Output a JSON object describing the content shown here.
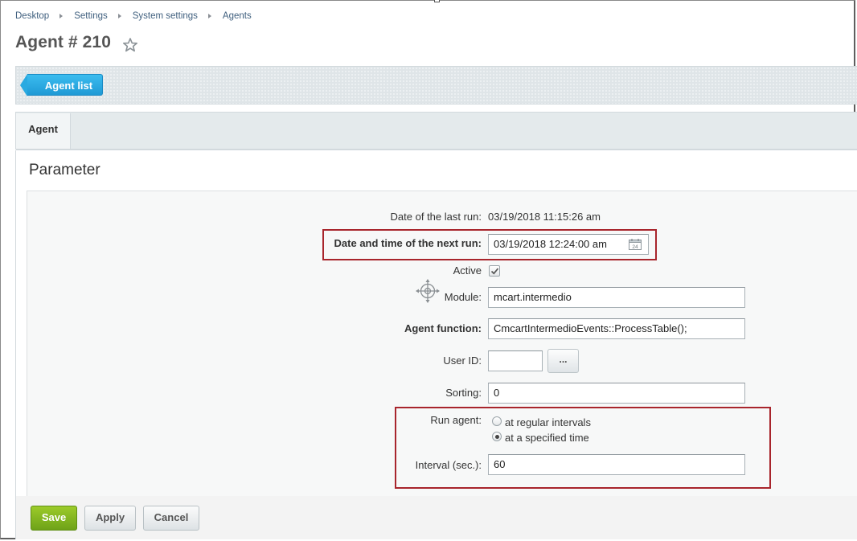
{
  "breadcrumb": [
    "Desktop",
    "Settings",
    "System settings",
    "Agents"
  ],
  "page": {
    "title": "Agent # 210"
  },
  "toolbar": {
    "agent_list_label": "Agent list"
  },
  "tabs": [
    {
      "label": "Agent"
    }
  ],
  "section": {
    "title": "Parameter"
  },
  "form": {
    "last_run": {
      "label": "Date of the last run:",
      "value": "03/19/2018 11:15:26 am"
    },
    "next_run": {
      "label": "Date and time of the next run:",
      "value": "03/19/2018 12:24:00 am"
    },
    "active": {
      "label": "Active",
      "checked": true
    },
    "module": {
      "label": "Module:",
      "value": "mcart.intermedio"
    },
    "agent_function": {
      "label": "Agent function:",
      "value": "CmcartIntermedioEvents::ProcessTable();"
    },
    "user_id": {
      "label": "User ID:",
      "value": "",
      "button_label": "..."
    },
    "sorting": {
      "label": "Sorting:",
      "value": "0"
    },
    "run_agent": {
      "label": "Run agent:",
      "options": [
        "at regular intervals",
        "at a specified time"
      ],
      "selected": "at a specified time"
    },
    "interval": {
      "label": "Interval (sec.):",
      "value": "60"
    }
  },
  "buttons": {
    "save": "Save",
    "apply": "Apply",
    "cancel": "Cancel"
  },
  "colors": {
    "accent_blue": "#1f9ad5",
    "save_green": "#7ab01f",
    "highlight_red": "#a8252c",
    "link": "#3f5f7e"
  }
}
